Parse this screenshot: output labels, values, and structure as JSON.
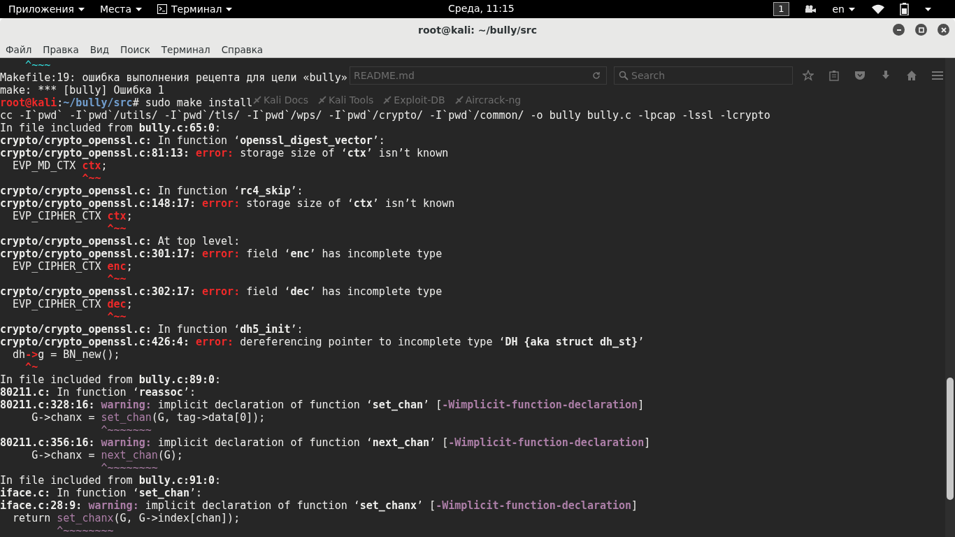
{
  "top_bar": {
    "menus": [
      {
        "label": "Приложения",
        "kind": "plain"
      },
      {
        "label": "Места",
        "kind": "plain"
      },
      {
        "label": "Терминал",
        "kind": "app"
      }
    ],
    "clock": "Среда, 11:15",
    "workspace": "1",
    "keyboard": "en"
  },
  "window": {
    "title": "root@kali: ~/bully/src",
    "menu": [
      "Файл",
      "Правка",
      "Вид",
      "Поиск",
      "Терминал",
      "Справка"
    ]
  },
  "background_browser": {
    "address": "README.md",
    "search_placeholder": "Search",
    "bookmarks": [
      "Kali Docs",
      "Kali Tools",
      "Exploit-DB",
      "Aircrack-ng"
    ]
  },
  "terminal": {
    "lines": [
      [
        {
          "t": "    ^~~~",
          "kind": "marker"
        }
      ],
      [
        {
          "t": "Makefile:19: ошибка выполнения рецепта для цели «bully»",
          "kind": "plain"
        }
      ],
      [
        {
          "t": "make: *** [bully] Ошибка 1",
          "kind": "plain"
        }
      ],
      [
        {
          "t": "root@kali",
          "kind": "prompt"
        },
        {
          "t": ":",
          "kind": "plain"
        },
        {
          "t": "~/bully/src",
          "kind": "path"
        },
        {
          "t": "# sudo make install",
          "kind": "plain"
        }
      ],
      [
        {
          "t": "cc -I`pwd` -I`pwd`/utils/ -I`pwd`/tls/ -I`pwd`/wps/ -I`pwd`/crypto/ -I`pwd`/common/ -o bully bully.c -lpcap -lssl -lcrypto",
          "kind": "plain"
        }
      ],
      [
        {
          "t": "In file included from ",
          "kind": "plain"
        },
        {
          "t": "bully.c:65:0",
          "kind": "bold"
        },
        {
          "t": ":",
          "kind": "plain"
        }
      ],
      [
        {
          "t": "crypto/crypto_openssl.c:",
          "kind": "bold"
        },
        {
          "t": " In function ‘",
          "kind": "plain"
        },
        {
          "t": "openssl_digest_vector",
          "kind": "bold"
        },
        {
          "t": "’:",
          "kind": "plain"
        }
      ],
      [
        {
          "t": "crypto/crypto_openssl.c:81:13: ",
          "kind": "bold"
        },
        {
          "t": "error:",
          "kind": "error"
        },
        {
          "t": " storage size of ‘",
          "kind": "plain"
        },
        {
          "t": "ctx",
          "kind": "bold"
        },
        {
          "t": "’ isn’t known",
          "kind": "plain"
        }
      ],
      [
        {
          "t": "  EVP_MD_CTX ",
          "kind": "plain"
        },
        {
          "t": "ctx",
          "kind": "error"
        },
        {
          "t": ";",
          "kind": "plain"
        }
      ],
      [
        {
          "t": "             ^~~",
          "kind": "error"
        }
      ],
      [
        {
          "t": "crypto/crypto_openssl.c:",
          "kind": "bold"
        },
        {
          "t": " In function ‘",
          "kind": "plain"
        },
        {
          "t": "rc4_skip",
          "kind": "bold"
        },
        {
          "t": "’:",
          "kind": "plain"
        }
      ],
      [
        {
          "t": "crypto/crypto_openssl.c:148:17: ",
          "kind": "bold"
        },
        {
          "t": "error:",
          "kind": "error"
        },
        {
          "t": " storage size of ‘",
          "kind": "plain"
        },
        {
          "t": "ctx",
          "kind": "bold"
        },
        {
          "t": "’ isn’t known",
          "kind": "plain"
        }
      ],
      [
        {
          "t": "  EVP_CIPHER_CTX ",
          "kind": "plain"
        },
        {
          "t": "ctx",
          "kind": "error"
        },
        {
          "t": ";",
          "kind": "plain"
        }
      ],
      [
        {
          "t": "                 ^~~",
          "kind": "error"
        }
      ],
      [
        {
          "t": "crypto/crypto_openssl.c:",
          "kind": "bold"
        },
        {
          "t": " At top level:",
          "kind": "plain"
        }
      ],
      [
        {
          "t": "crypto/crypto_openssl.c:301:17: ",
          "kind": "bold"
        },
        {
          "t": "error:",
          "kind": "error"
        },
        {
          "t": " field ‘",
          "kind": "plain"
        },
        {
          "t": "enc",
          "kind": "bold"
        },
        {
          "t": "’ has incomplete type",
          "kind": "plain"
        }
      ],
      [
        {
          "t": "  EVP_CIPHER_CTX ",
          "kind": "plain"
        },
        {
          "t": "enc",
          "kind": "error"
        },
        {
          "t": ";",
          "kind": "plain"
        }
      ],
      [
        {
          "t": "                 ^~~",
          "kind": "error"
        }
      ],
      [
        {
          "t": "crypto/crypto_openssl.c:302:17: ",
          "kind": "bold"
        },
        {
          "t": "error:",
          "kind": "error"
        },
        {
          "t": " field ‘",
          "kind": "plain"
        },
        {
          "t": "dec",
          "kind": "bold"
        },
        {
          "t": "’ has incomplete type",
          "kind": "plain"
        }
      ],
      [
        {
          "t": "  EVP_CIPHER_CTX ",
          "kind": "plain"
        },
        {
          "t": "dec",
          "kind": "error"
        },
        {
          "t": ";",
          "kind": "plain"
        }
      ],
      [
        {
          "t": "                 ^~~",
          "kind": "error"
        }
      ],
      [
        {
          "t": "crypto/crypto_openssl.c:",
          "kind": "bold"
        },
        {
          "t": " In function ‘",
          "kind": "plain"
        },
        {
          "t": "dh5_init",
          "kind": "bold"
        },
        {
          "t": "’:",
          "kind": "plain"
        }
      ],
      [
        {
          "t": "crypto/crypto_openssl.c:426:4: ",
          "kind": "bold"
        },
        {
          "t": "error:",
          "kind": "error"
        },
        {
          "t": " dereferencing pointer to incomplete type ‘",
          "kind": "plain"
        },
        {
          "t": "DH {aka struct dh_st}",
          "kind": "bold"
        },
        {
          "t": "’",
          "kind": "plain"
        }
      ],
      [
        {
          "t": "  dh",
          "kind": "plain"
        },
        {
          "t": "->",
          "kind": "error"
        },
        {
          "t": "g = BN_new();",
          "kind": "plain"
        }
      ],
      [
        {
          "t": "    ^~",
          "kind": "error"
        }
      ],
      [
        {
          "t": "In file included from ",
          "kind": "plain"
        },
        {
          "t": "bully.c:89:0",
          "kind": "bold"
        },
        {
          "t": ":",
          "kind": "plain"
        }
      ],
      [
        {
          "t": "80211.c:",
          "kind": "bold"
        },
        {
          "t": " In function ‘",
          "kind": "plain"
        },
        {
          "t": "reassoc",
          "kind": "bold"
        },
        {
          "t": "’:",
          "kind": "plain"
        }
      ],
      [
        {
          "t": "80211.c:328:16: ",
          "kind": "bold"
        },
        {
          "t": "warning:",
          "kind": "warning"
        },
        {
          "t": " implicit declaration of function ‘",
          "kind": "plain"
        },
        {
          "t": "set_chan",
          "kind": "bold"
        },
        {
          "t": "’ [",
          "kind": "plain"
        },
        {
          "t": "-Wimplicit-function-declaration",
          "kind": "warning"
        },
        {
          "t": "]",
          "kind": "plain"
        }
      ],
      [
        {
          "t": "     G->chanx = ",
          "kind": "plain"
        },
        {
          "t": "set_chan",
          "kind": "highlight"
        },
        {
          "t": "(G, tag->data[0]);",
          "kind": "plain"
        }
      ],
      [
        {
          "t": "                ^~~~~~~~",
          "kind": "highlight"
        }
      ],
      [
        {
          "t": "80211.c:356:16: ",
          "kind": "bold"
        },
        {
          "t": "warning:",
          "kind": "warning"
        },
        {
          "t": " implicit declaration of function ‘",
          "kind": "plain"
        },
        {
          "t": "next_chan",
          "kind": "bold"
        },
        {
          "t": "’ [",
          "kind": "plain"
        },
        {
          "t": "-Wimplicit-function-declaration",
          "kind": "warning"
        },
        {
          "t": "]",
          "kind": "plain"
        }
      ],
      [
        {
          "t": "     G->chanx = ",
          "kind": "plain"
        },
        {
          "t": "next_chan",
          "kind": "highlight"
        },
        {
          "t": "(G);",
          "kind": "plain"
        }
      ],
      [
        {
          "t": "                ^~~~~~~~~",
          "kind": "highlight"
        }
      ],
      [
        {
          "t": "In file included from ",
          "kind": "plain"
        },
        {
          "t": "bully.c:91:0",
          "kind": "bold"
        },
        {
          "t": ":",
          "kind": "plain"
        }
      ],
      [
        {
          "t": "iface.c:",
          "kind": "bold"
        },
        {
          "t": " In function ‘",
          "kind": "plain"
        },
        {
          "t": "set_chan",
          "kind": "bold"
        },
        {
          "t": "’:",
          "kind": "plain"
        }
      ],
      [
        {
          "t": "iface.c:28:9: ",
          "kind": "bold"
        },
        {
          "t": "warning:",
          "kind": "warning"
        },
        {
          "t": " implicit declaration of function ‘",
          "kind": "plain"
        },
        {
          "t": "set_chanx",
          "kind": "bold"
        },
        {
          "t": "’ [",
          "kind": "plain"
        },
        {
          "t": "-Wimplicit-function-declaration",
          "kind": "warning"
        },
        {
          "t": "]",
          "kind": "plain"
        }
      ],
      [
        {
          "t": "  return ",
          "kind": "plain"
        },
        {
          "t": "set_chanx",
          "kind": "highlight"
        },
        {
          "t": "(G, G->index[chan]);",
          "kind": "plain"
        }
      ],
      [
        {
          "t": "         ^~~~~~~~~",
          "kind": "highlight"
        }
      ]
    ]
  }
}
